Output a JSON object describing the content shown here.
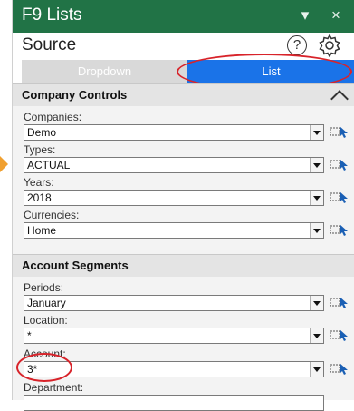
{
  "window": {
    "title": "F9 Lists",
    "minimize_glyph": "▾",
    "close_glyph": "×"
  },
  "header": {
    "label": "Source",
    "help_glyph": "?"
  },
  "mode_toggle": {
    "left_label": "Dropdown",
    "right_label": "List",
    "selected": "List"
  },
  "sections": {
    "company": {
      "title": "Company Controls",
      "fields": [
        {
          "label": "Companies:",
          "value": "Demo"
        },
        {
          "label": "Types:",
          "value": "ACTUAL"
        },
        {
          "label": "Years:",
          "value": "2018"
        },
        {
          "label": "Currencies:",
          "value": "Home"
        }
      ]
    },
    "account": {
      "title": "Account Segments",
      "fields": [
        {
          "label": "Periods:",
          "value": "January"
        },
        {
          "label": "Location:",
          "value": "*"
        },
        {
          "label": "Account:",
          "value": "3*"
        },
        {
          "label": "Department:",
          "value": ""
        }
      ]
    }
  },
  "colors": {
    "title_bar": "#217346",
    "selected_toggle": "#1a73e8",
    "highlight_ring": "#d8232a",
    "pointer_arrow": "#f0a030"
  },
  "icons": {
    "minimize": "chevron-down-icon",
    "close": "close-icon",
    "help": "help-icon",
    "settings": "gear-icon",
    "collapse": "chevron-up-icon",
    "dropdown": "dropdown-arrow-icon",
    "picker": "select-from-sheet-icon"
  }
}
